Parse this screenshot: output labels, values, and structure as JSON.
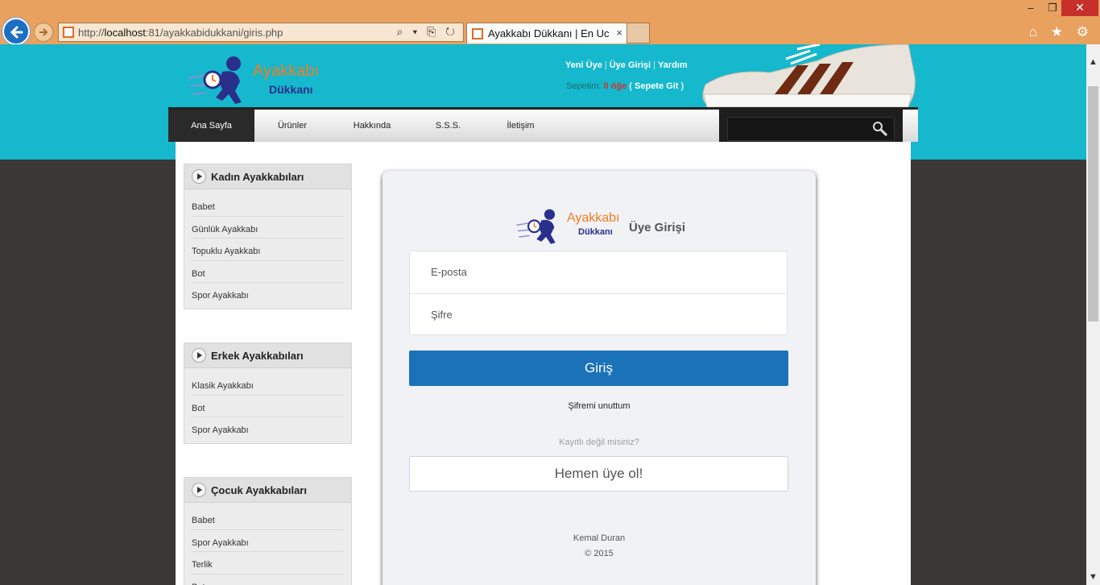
{
  "browser": {
    "url_prefix": "http://",
    "url_host": "localhost",
    "url_rest": ":81/ayakkabidukkani/giris.php",
    "tab_title": "Ayakkabı Dükkanı | En Ucuz...",
    "tab_close": "×",
    "min_glyph": "–",
    "max_glyph": "❐",
    "close_glyph": "✕",
    "tools_glyphs": "⌕ ▾ ⎘ ↻",
    "icons_glyphs": "⌂ ★ ⚙"
  },
  "header": {
    "logo_word1": "Ayakkabı",
    "logo_word2": "Dükkanı",
    "links": [
      "Yeni Üye",
      "Üye Girişi",
      "Yardım"
    ],
    "separator": "|",
    "cart_label": "Sepetim:",
    "cart_count": "0 öğe",
    "cart_open_paren": "(",
    "cart_link": "Sepete Git",
    "cart_close_paren": ")"
  },
  "nav": {
    "items": [
      "Ana Sayfa",
      "Ürünler",
      "Hakkında",
      "S.S.S.",
      "İletişim"
    ],
    "active_index": 0
  },
  "search": {
    "placeholder": ""
  },
  "sidebar": {
    "categories": [
      {
        "title": "Kadın Ayakkabıları",
        "items": [
          "Babet",
          "Günlük Ayakkabı",
          "Topuklu Ayakkabı",
          "Bot",
          "Spor Ayakkabı"
        ]
      },
      {
        "title": "Erkek Ayakkabıları",
        "items": [
          "Klasik Ayakkabı",
          "Bot",
          "Spor Ayakkabı"
        ]
      },
      {
        "title": "Çocuk Ayakkabıları",
        "items": [
          "Babet",
          "Spor Ayakkabı",
          "Terlik",
          "Bot"
        ]
      }
    ]
  },
  "login": {
    "logo_word1": "Ayakkabı",
    "logo_word2": "Dükkanı",
    "title": "Üye Girişi",
    "email_placeholder": "E-posta",
    "password_placeholder": "Şifre",
    "submit_label": "Giriş",
    "forgot_label": "Şifremi unuttum",
    "not_member": "Kayıtlı değil misiniz?",
    "signup_label": "Hemen üye ol!",
    "footer_name": "Kemal Duran",
    "footer_year": "© 2015"
  },
  "colors": {
    "header_bg": "#15b8cc",
    "page_bg": "#3b3737",
    "primary_button": "#1b72b8",
    "logo_orange": "#f07c24",
    "logo_blue": "#2b2f8c",
    "browser_frame": "#e8a15f"
  }
}
